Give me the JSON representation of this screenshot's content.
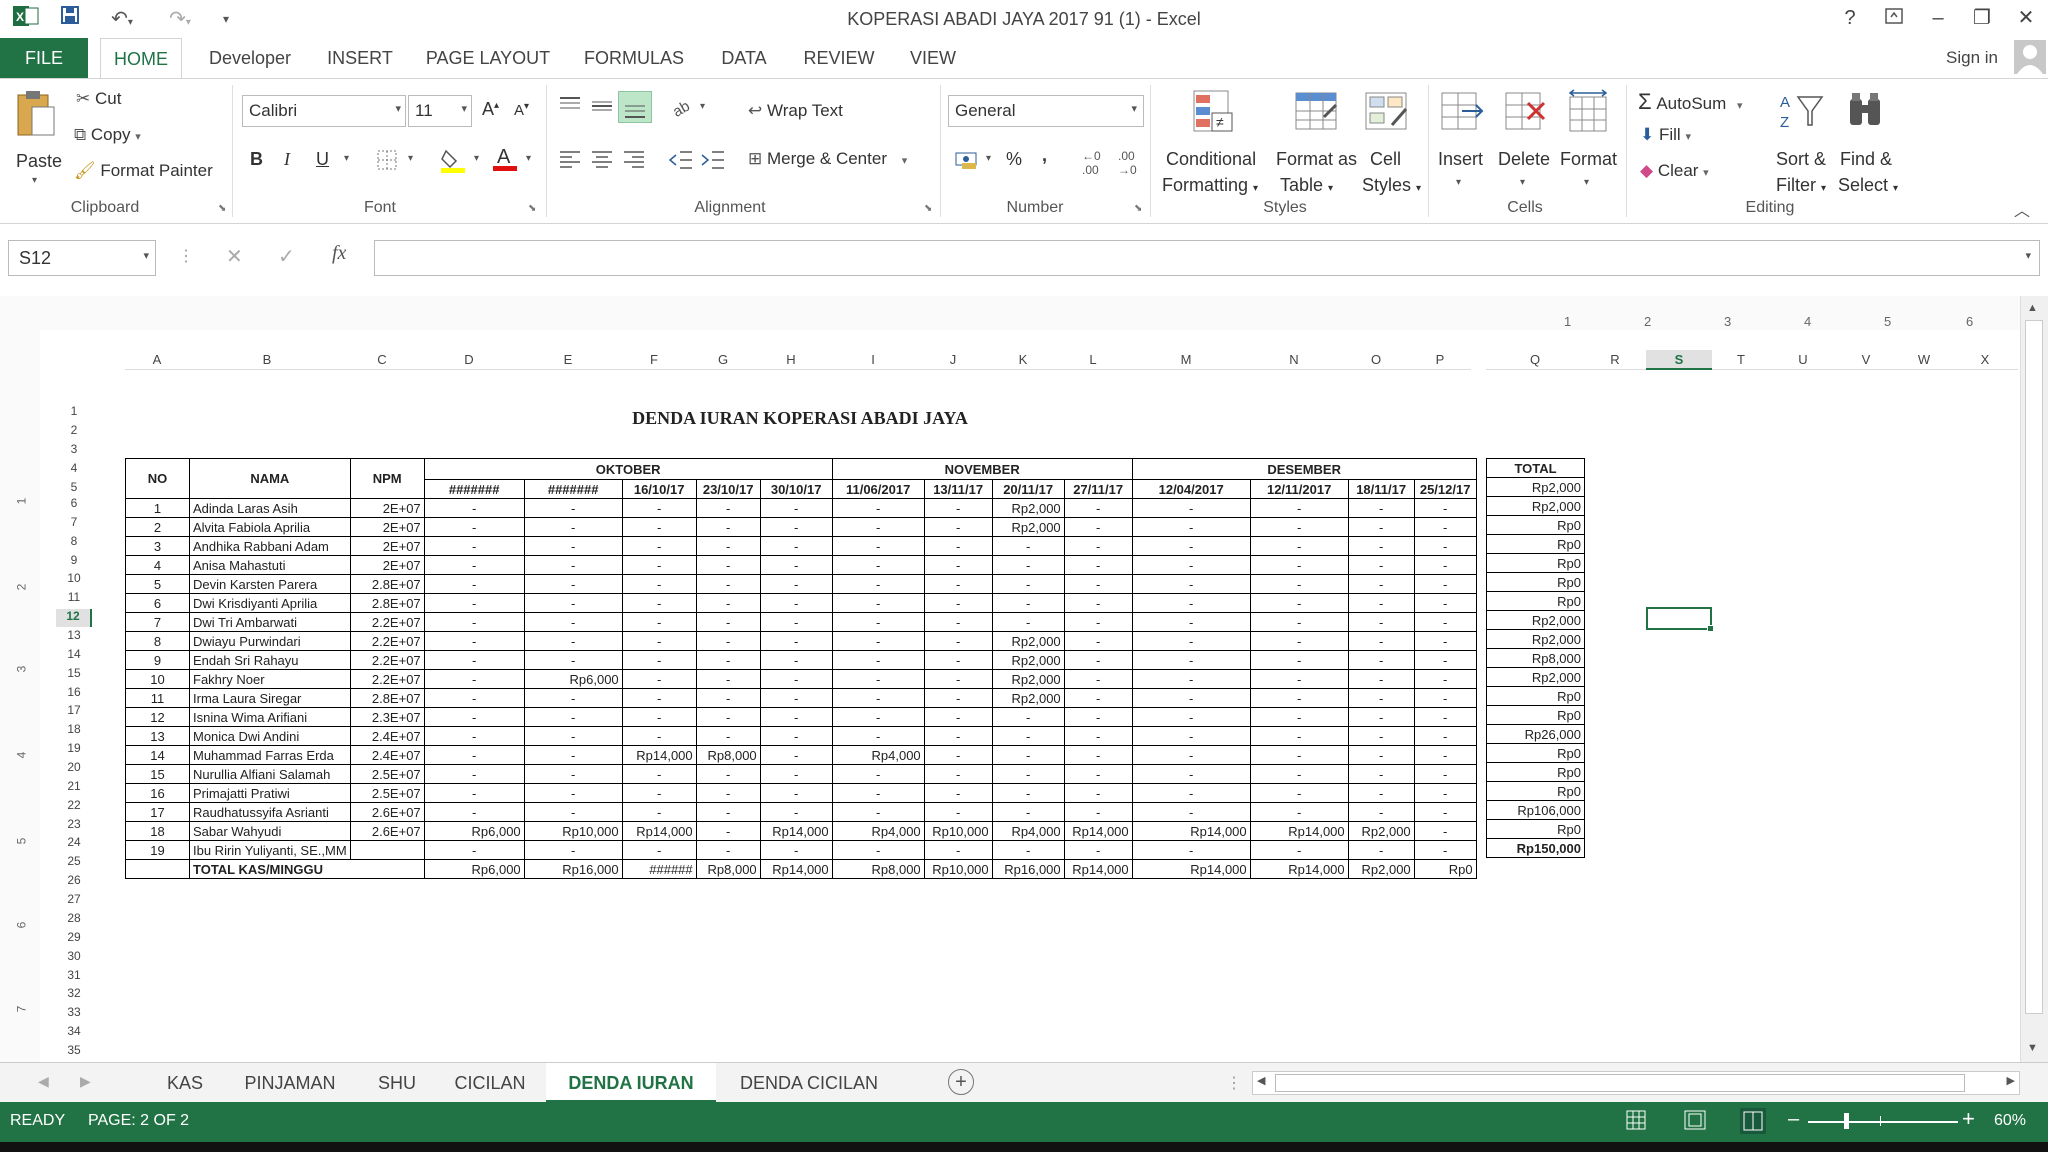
{
  "window": {
    "title": "KOPERASI ABADI JAYA 2017 91 (1) - Excel",
    "help": "?",
    "sign_in": "Sign in"
  },
  "tabs": [
    "FILE",
    "HOME",
    "Developer",
    "INSERT",
    "PAGE LAYOUT",
    "FORMULAS",
    "DATA",
    "REVIEW",
    "VIEW"
  ],
  "clipboard": {
    "paste": "Paste",
    "cut": "Cut",
    "copy": "Copy",
    "format_painter": "Format Painter",
    "group": "Clipboard"
  },
  "font": {
    "name": "Calibri",
    "size": "11",
    "group": "Font"
  },
  "alignment": {
    "wrap": "Wrap Text",
    "merge": "Merge & Center",
    "group": "Alignment"
  },
  "number": {
    "format": "General",
    "percent": "%",
    "comma": ",",
    "group": "Number"
  },
  "styles": {
    "cond1": "Conditional",
    "cond2": "Formatting",
    "fmt1": "Format as",
    "fmt2": "Table",
    "cell1": "Cell",
    "cell2": "Styles",
    "group": "Styles"
  },
  "cells": {
    "insert": "Insert",
    "delete": "Delete",
    "format": "Format",
    "group": "Cells"
  },
  "editing": {
    "autosum": "AutoSum",
    "fill": "Fill",
    "clear": "Clear",
    "sort1": "Sort &",
    "sort2": "Filter",
    "find1": "Find &",
    "find2": "Select",
    "group": "Editing"
  },
  "formula_bar": {
    "name_box": "S12",
    "fx": "fx",
    "value": ""
  },
  "ruler": [
    "1",
    "2",
    "3",
    "4",
    "5",
    "6"
  ],
  "columns": [
    "A",
    "B",
    "C",
    "D",
    "E",
    "F",
    "G",
    "H",
    "I",
    "J",
    "K",
    "L",
    "M",
    "N",
    "O",
    "P",
    "Q",
    "R",
    "S",
    "T",
    "U",
    "V",
    "W",
    "X"
  ],
  "rows": [
    "1",
    "2",
    "3",
    "4",
    "5",
    "6",
    "7",
    "8",
    "9",
    "10",
    "11",
    "12",
    "13",
    "14",
    "15",
    "16",
    "17",
    "18",
    "19",
    "20",
    "21",
    "22",
    "23",
    "24",
    "25",
    "26",
    "27",
    "28",
    "29",
    "30",
    "31",
    "32",
    "33",
    "34",
    "35"
  ],
  "left_ruler": [
    "1",
    "2",
    "3",
    "4",
    "5",
    "6",
    "7"
  ],
  "sheet": {
    "title": "DENDA IURAN KOPERASI ABADI JAYA",
    "h_no": "NO",
    "h_nama": "NAMA",
    "h_npm": "NPM",
    "h_total": "TOTAL",
    "months": [
      "OKTOBER",
      "NOVEMBER",
      "DESEMBER"
    ],
    "dates": [
      "#######",
      "#######",
      "16/10/17",
      "23/10/17",
      "30/10/17",
      "11/06/2017",
      "13/11/17",
      "20/11/17",
      "27/11/17",
      "12/04/2017",
      "12/11/2017",
      "18/11/17",
      "25/12/17"
    ],
    "rows": [
      [
        "1",
        "Adinda Laras Asih",
        "2E+07",
        "-",
        "-",
        "-",
        "-",
        "-",
        "-",
        "-",
        "Rp2,000",
        "-",
        "-",
        "-",
        "-",
        "-",
        "Rp2,000"
      ],
      [
        "2",
        "Alvita Fabiola Aprilia",
        "2E+07",
        "-",
        "-",
        "-",
        "-",
        "-",
        "-",
        "-",
        "Rp2,000",
        "-",
        "-",
        "-",
        "-",
        "-",
        "Rp2,000"
      ],
      [
        "3",
        "Andhika Rabbani Adam",
        "2E+07",
        "-",
        "-",
        "-",
        "-",
        "-",
        "-",
        "-",
        "-",
        "-",
        "-",
        "-",
        "-",
        "-",
        "Rp0"
      ],
      [
        "4",
        "Anisa Mahastuti",
        "2E+07",
        "-",
        "-",
        "-",
        "-",
        "-",
        "-",
        "-",
        "-",
        "-",
        "-",
        "-",
        "-",
        "-",
        "Rp0"
      ],
      [
        "5",
        "Devin Karsten Parera",
        "2.8E+07",
        "-",
        "-",
        "-",
        "-",
        "-",
        "-",
        "-",
        "-",
        "-",
        "-",
        "-",
        "-",
        "-",
        "Rp0"
      ],
      [
        "6",
        "Dwi Krisdiyanti Aprilia",
        "2.8E+07",
        "-",
        "-",
        "-",
        "-",
        "-",
        "-",
        "-",
        "-",
        "-",
        "-",
        "-",
        "-",
        "-",
        "Rp0"
      ],
      [
        "7",
        "Dwi Tri Ambarwati",
        "2.2E+07",
        "-",
        "-",
        "-",
        "-",
        "-",
        "-",
        "-",
        "-",
        "-",
        "-",
        "-",
        "-",
        "-",
        "Rp0"
      ],
      [
        "8",
        "Dwiayu Purwindari",
        "2.2E+07",
        "-",
        "-",
        "-",
        "-",
        "-",
        "-",
        "-",
        "Rp2,000",
        "-",
        "-",
        "-",
        "-",
        "-",
        "Rp2,000"
      ],
      [
        "9",
        "Endah Sri Rahayu",
        "2.2E+07",
        "-",
        "-",
        "-",
        "-",
        "-",
        "-",
        "-",
        "Rp2,000",
        "-",
        "-",
        "-",
        "-",
        "-",
        "Rp2,000"
      ],
      [
        "10",
        "Fakhry Noer",
        "2.2E+07",
        "-",
        "Rp6,000",
        "-",
        "-",
        "-",
        "-",
        "-",
        "Rp2,000",
        "-",
        "-",
        "-",
        "-",
        "-",
        "Rp8,000"
      ],
      [
        "11",
        "Irma Laura Siregar",
        "2.8E+07",
        "-",
        "-",
        "-",
        "-",
        "-",
        "-",
        "-",
        "Rp2,000",
        "-",
        "-",
        "-",
        "-",
        "-",
        "Rp2,000"
      ],
      [
        "12",
        "Isnina Wima Arifiani",
        "2.3E+07",
        "-",
        "-",
        "-",
        "-",
        "-",
        "-",
        "-",
        "-",
        "-",
        "-",
        "-",
        "-",
        "-",
        "Rp0"
      ],
      [
        "13",
        "Monica Dwi Andini",
        "2.4E+07",
        "-",
        "-",
        "-",
        "-",
        "-",
        "-",
        "-",
        "-",
        "-",
        "-",
        "-",
        "-",
        "-",
        "Rp0"
      ],
      [
        "14",
        "Muhammad Farras Erda",
        "2.4E+07",
        "-",
        "-",
        "Rp14,000",
        "Rp8,000",
        "-",
        "Rp4,000",
        "-",
        "-",
        "-",
        "-",
        "-",
        "-",
        "-",
        "Rp26,000"
      ],
      [
        "15",
        "Nurullia Alfiani Salamah",
        "2.5E+07",
        "-",
        "-",
        "-",
        "-",
        "-",
        "-",
        "-",
        "-",
        "-",
        "-",
        "-",
        "-",
        "-",
        "Rp0"
      ],
      [
        "16",
        "Primajatti Pratiwi",
        "2.5E+07",
        "-",
        "-",
        "-",
        "-",
        "-",
        "-",
        "-",
        "-",
        "-",
        "-",
        "-",
        "-",
        "-",
        "Rp0"
      ],
      [
        "17",
        "Raudhatussyifa Asrianti",
        "2.6E+07",
        "-",
        "-",
        "-",
        "-",
        "-",
        "-",
        "-",
        "-",
        "-",
        "-",
        "-",
        "-",
        "-",
        "Rp0"
      ],
      [
        "18",
        "Sabar Wahyudi",
        "2.6E+07",
        "Rp6,000",
        "Rp10,000",
        "Rp14,000",
        "-",
        "Rp14,000",
        "Rp4,000",
        "Rp10,000",
        "Rp4,000",
        "Rp14,000",
        "Rp14,000",
        "Rp14,000",
        "Rp2,000",
        "-",
        "Rp106,000"
      ],
      [
        "19",
        "Ibu Ririn Yuliyanti, SE.,MM",
        "",
        "-",
        "-",
        "-",
        "-",
        "-",
        "-",
        "-",
        "-",
        "-",
        "-",
        "-",
        "-",
        "-",
        "Rp0"
      ]
    ],
    "total_label": "TOTAL KAS/MINGGU",
    "totals": [
      "Rp6,000",
      "Rp16,000",
      "######",
      "Rp8,000",
      "Rp14,000",
      "Rp8,000",
      "Rp10,000",
      "Rp16,000",
      "Rp14,000",
      "Rp14,000",
      "Rp14,000",
      "Rp2,000",
      "Rp0"
    ],
    "grand_total": "Rp150,000"
  },
  "sheet_tabs": [
    "KAS",
    "PINJAMAN",
    "SHU",
    "CICILAN",
    "DENDA IURAN",
    "DENDA CICILAN"
  ],
  "status": {
    "ready": "READY",
    "page": "PAGE: 2 OF 2",
    "zoom": "60%"
  },
  "colors": {
    "accent": "#217346"
  }
}
